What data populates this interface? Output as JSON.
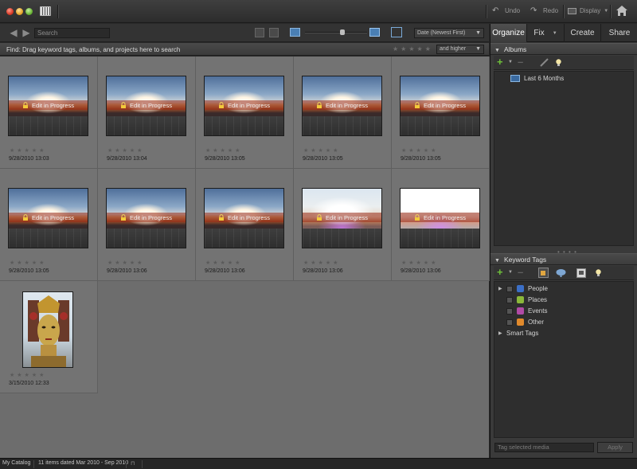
{
  "titlebar": {
    "undo_label": "Undo",
    "redo_label": "Redo",
    "display_label": "Display"
  },
  "toolbar": {
    "search_placeholder": "Search",
    "sort_value": "Date (Newest First)"
  },
  "findbar": {
    "text": "Find: Drag keyword tags, albums, and projects here to search",
    "stars": "★★★★★",
    "rating_value": "and higher"
  },
  "media": {
    "edit_label": "Edit in Progress",
    "stars": "★★★★★",
    "items": [
      {
        "date": "9/28/2010 13:03",
        "edit": true
      },
      {
        "date": "9/28/2010 13:04",
        "edit": true
      },
      {
        "date": "9/28/2010 13:05",
        "edit": true
      },
      {
        "date": "9/28/2010 13:05",
        "edit": true
      },
      {
        "date": "9/28/2010 13:05",
        "edit": true
      },
      {
        "date": "9/28/2010 13:05",
        "edit": true
      },
      {
        "date": "9/28/2010 13:06",
        "edit": true
      },
      {
        "date": "9/28/2010 13:06",
        "edit": true
      },
      {
        "date": "9/28/2010 13:06",
        "edit": true
      },
      {
        "date": "9/28/2010 13:06",
        "edit": true
      },
      {
        "date": "3/15/2010 12:33",
        "edit": false
      }
    ]
  },
  "tabs": [
    {
      "label": "Organize"
    },
    {
      "label": "Fix"
    },
    {
      "label": "Create"
    },
    {
      "label": "Share"
    }
  ],
  "albums": {
    "title": "Albums",
    "items": [
      {
        "label": "Last 6 Months"
      }
    ]
  },
  "keyword_tags": {
    "title": "Keyword Tags",
    "items": [
      {
        "label": "People",
        "color": "#3b6fc7"
      },
      {
        "label": "Places",
        "color": "#8bb83a"
      },
      {
        "label": "Events",
        "color": "#b14aa6"
      },
      {
        "label": "Other",
        "color": "#e18a2c"
      }
    ],
    "smart_tags_label": "Smart Tags",
    "input_placeholder": "Tag selected media",
    "apply_label": "Apply"
  },
  "statusbar": {
    "catalog": "My Catalog",
    "summary": "11 items dated Mar 2010 - Sep 2010"
  }
}
